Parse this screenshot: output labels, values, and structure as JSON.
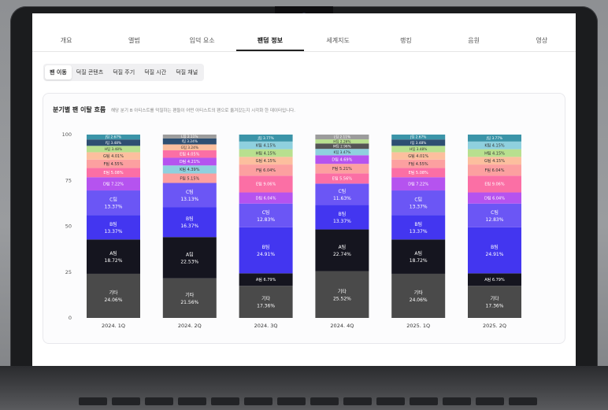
{
  "tabs": [
    "개요",
    "앨범",
    "입덕 요소",
    "팬덤 정보",
    "세계지도",
    "랭킹",
    "음원",
    "영상"
  ],
  "active_tab": 3,
  "subtabs": [
    "팬 이동",
    "덕질 콘텐츠",
    "덕질 주기",
    "덕질 시간",
    "덕질 채널"
  ],
  "active_subtab": 0,
  "card": {
    "title": "분기별 팬 이탈 흐름",
    "description": "해당 분기 B 아티스트를 덕질하는 팬들이 어떤 아티스트의 팬으로 옮겨갔는지 시각화 한 데이터입니다."
  },
  "chart_data": {
    "type": "bar",
    "stacked": true,
    "percent": true,
    "ylim": [
      0,
      100
    ],
    "yticks": [
      0,
      25,
      50,
      75,
      100
    ],
    "categories": [
      "2024. 1Q",
      "2024. 2Q",
      "2024. 3Q",
      "2024. 4Q",
      "2025. 1Q",
      "2025. 2Q"
    ],
    "colors": {
      "기타": "#4a4a4a",
      "A팀": "#15151f",
      "B팀": "#4336f0",
      "C팀": "#6b56f5",
      "D팀": "#b553ef",
      "E팀": "#fb6fa5",
      "F팀": "#fca0a0",
      "G팀": "#fcbf9e",
      "H팀": "#b8e08f",
      "I팀": "#2e4f72",
      "J팀": "#3b94a8",
      "K팀": "#8fd0de",
      "L팀": "#9c9c9c",
      "M팀": "#555555"
    },
    "stacks": [
      [
        {
          "name": "기타",
          "value": 24.06,
          "label": "24.06%"
        },
        {
          "name": "A팀",
          "value": 18.72,
          "label": "18.72%"
        },
        {
          "name": "B팀",
          "value": 13.37,
          "label": "13.37%"
        },
        {
          "name": "C팀",
          "value": 13.37,
          "label": "13.37%"
        },
        {
          "name": "D팀",
          "value": 7.22,
          "label": "7.22%"
        },
        {
          "name": "E팀",
          "value": 5.08,
          "label": "5.08%"
        },
        {
          "name": "F팀",
          "value": 4.55,
          "label": "4.55%"
        },
        {
          "name": "G팀",
          "value": 4.01,
          "label": "4.01%"
        },
        {
          "name": "H팀",
          "value": 3.48,
          "label": "3.48%"
        },
        {
          "name": "I팀",
          "value": 3.48,
          "label": "3.48%"
        },
        {
          "name": "J팀",
          "value": 2.67,
          "label": "2.67%"
        }
      ],
      [
        {
          "name": "기타",
          "value": 21.56,
          "label": "21.56%"
        },
        {
          "name": "A팀",
          "value": 22.53,
          "label": "22.53%"
        },
        {
          "name": "B팀",
          "value": 16.37,
          "label": "16.37%"
        },
        {
          "name": "C팀",
          "value": 13.13,
          "label": "13.13%"
        },
        {
          "name": "F팀",
          "value": 5.15,
          "label": "5.15%"
        },
        {
          "name": "K팀",
          "value": 4.39,
          "label": "4.39%"
        },
        {
          "name": "D팀",
          "value": 4.21,
          "label": "4.21%"
        },
        {
          "name": "E팀",
          "value": 4.05,
          "label": "4.05%"
        },
        {
          "name": "G팀",
          "value": 3.24,
          "label": "3.24%"
        },
        {
          "name": "I팀",
          "value": 3.24,
          "label": "3.24%"
        },
        {
          "name": "L팀",
          "value": 2.11,
          "label": "2.11%"
        }
      ],
      [
        {
          "name": "기타",
          "value": 17.36,
          "label": "17.36%"
        },
        {
          "name": "A팀",
          "value": 6.79,
          "label": "6.79%"
        },
        {
          "name": "B팀",
          "value": 24.91,
          "label": "24.91%"
        },
        {
          "name": "C팀",
          "value": 12.83,
          "label": "12.83%"
        },
        {
          "name": "D팀",
          "value": 6.04,
          "label": "6.04%"
        },
        {
          "name": "E팀",
          "value": 9.06,
          "label": "9.06%"
        },
        {
          "name": "F팀",
          "value": 6.04,
          "label": "6.04%"
        },
        {
          "name": "G팀",
          "value": 4.15,
          "label": "4.15%"
        },
        {
          "name": "H팀",
          "value": 4.15,
          "label": "4.15%"
        },
        {
          "name": "K팀",
          "value": 4.15,
          "label": "4.15%"
        },
        {
          "name": "J팀",
          "value": 3.77,
          "label": "3.77%"
        }
      ],
      [
        {
          "name": "기타",
          "value": 25.52,
          "label": "25.52%"
        },
        {
          "name": "A팀",
          "value": 22.74,
          "label": "22.74%"
        },
        {
          "name": "B팀",
          "value": 13.37,
          "label": "13.37%"
        },
        {
          "name": "C팀",
          "value": 11.63,
          "label": "11.63%"
        },
        {
          "name": "E팀",
          "value": 5.56,
          "label": "5.56%"
        },
        {
          "name": "F팀",
          "value": 5.21,
          "label": "5.21%"
        },
        {
          "name": "D팀",
          "value": 4.69,
          "label": "4.69%"
        },
        {
          "name": "K팀",
          "value": 3.47,
          "label": "3.47%"
        },
        {
          "name": "M팀",
          "value": 2.95,
          "label": "2.96%"
        },
        {
          "name": "H팀",
          "value": 2.25,
          "label": "2.26%"
        },
        {
          "name": "L팀",
          "value": 2.61,
          "label": "2.11%"
        }
      ],
      [
        {
          "name": "기타",
          "value": 24.06,
          "label": "24.06%"
        },
        {
          "name": "A팀",
          "value": 18.72,
          "label": "18.72%"
        },
        {
          "name": "B팀",
          "value": 13.37,
          "label": "13.37%"
        },
        {
          "name": "C팀",
          "value": 13.37,
          "label": "13.37%"
        },
        {
          "name": "D팀",
          "value": 7.22,
          "label": "7.22%"
        },
        {
          "name": "E팀",
          "value": 5.08,
          "label": "5.08%"
        },
        {
          "name": "F팀",
          "value": 4.55,
          "label": "4.55%"
        },
        {
          "name": "G팀",
          "value": 4.01,
          "label": "4.01%"
        },
        {
          "name": "H팀",
          "value": 3.48,
          "label": "3.48%"
        },
        {
          "name": "I팀",
          "value": 3.48,
          "label": "3.48%"
        },
        {
          "name": "J팀",
          "value": 2.67,
          "label": "2.67%"
        }
      ],
      [
        {
          "name": "기타",
          "value": 17.36,
          "label": "17.36%"
        },
        {
          "name": "A팀",
          "value": 6.79,
          "label": "6.79%"
        },
        {
          "name": "B팀",
          "value": 24.91,
          "label": "24.91%"
        },
        {
          "name": "C팀",
          "value": 12.83,
          "label": "12.83%"
        },
        {
          "name": "D팀",
          "value": 6.04,
          "label": "6.04%"
        },
        {
          "name": "E팀",
          "value": 9.06,
          "label": "9.06%"
        },
        {
          "name": "F팀",
          "value": 6.04,
          "label": "6.04%"
        },
        {
          "name": "G팀",
          "value": 4.15,
          "label": "4.15%"
        },
        {
          "name": "H팀",
          "value": 4.15,
          "label": "4.15%"
        },
        {
          "name": "K팀",
          "value": 4.15,
          "label": "4.15%"
        },
        {
          "name": "J팀",
          "value": 3.77,
          "label": "3.77%"
        }
      ]
    ]
  }
}
